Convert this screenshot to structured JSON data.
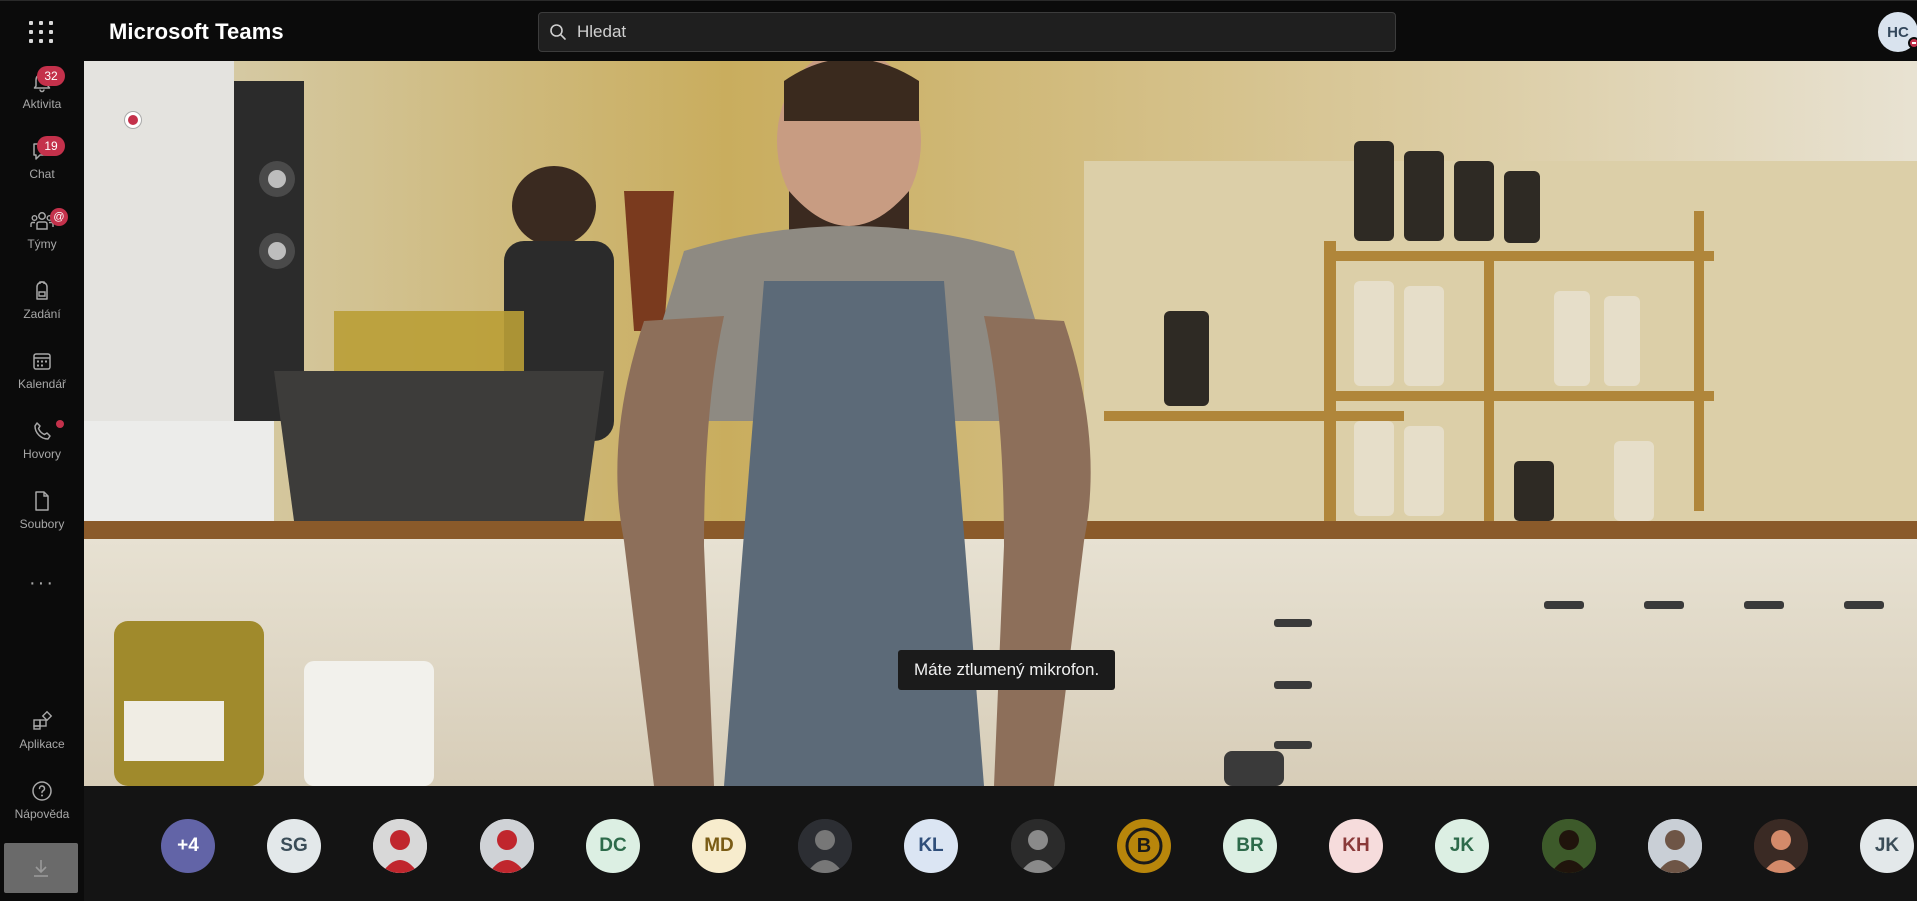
{
  "app": {
    "title": "Microsoft Teams"
  },
  "search": {
    "placeholder": "Hledat"
  },
  "user": {
    "initials": "HC",
    "presence": "busy"
  },
  "rail": {
    "items": [
      {
        "label": "Aktivita",
        "icon": "bell-icon",
        "badge": "32"
      },
      {
        "label": "Chat",
        "icon": "chat-icon",
        "badge": "19"
      },
      {
        "label": "Týmy",
        "icon": "teams-icon",
        "badge": "@"
      },
      {
        "label": "Zadání",
        "icon": "backpack-icon",
        "badge": ""
      },
      {
        "label": "Kalendář",
        "icon": "calendar-icon",
        "badge": ""
      },
      {
        "label": "Hovory",
        "icon": "phone-icon",
        "badge": "dot"
      },
      {
        "label": "Soubory",
        "icon": "file-icon",
        "badge": ""
      }
    ],
    "more": "···",
    "bottom": [
      {
        "label": "Aplikace",
        "icon": "apps-icon"
      },
      {
        "label": "Nápověda",
        "icon": "help-icon"
      }
    ]
  },
  "meeting": {
    "toast": "Máte ztlumený mikrofon.",
    "recording": true
  },
  "participants": [
    {
      "label": "+4",
      "kind": "overflow",
      "bg": "#6264a7",
      "fg": "#ffffff"
    },
    {
      "label": "SG",
      "kind": "initials",
      "bg": "#e3e8ea",
      "fg": "#3b4d58"
    },
    {
      "label": "",
      "kind": "photo",
      "bg": "#d8d8d8",
      "fg": "#c0262d"
    },
    {
      "label": "",
      "kind": "photo",
      "bg": "#cfd2d6",
      "fg": "#c0262d"
    },
    {
      "label": "DC",
      "kind": "initials",
      "bg": "#dcefe3",
      "fg": "#2d6a4a"
    },
    {
      "label": "MD",
      "kind": "initials",
      "bg": "#f7eccd",
      "fg": "#7a5c15"
    },
    {
      "label": "",
      "kind": "photo",
      "bg": "#2c2e33",
      "fg": "#777777"
    },
    {
      "label": "KL",
      "kind": "initials",
      "bg": "#dbe5f3",
      "fg": "#2f4e7a"
    },
    {
      "label": "",
      "kind": "photo",
      "bg": "#2b2b2b",
      "fg": "#8a8a8a"
    },
    {
      "label": "B",
      "kind": "logo",
      "bg": "#b8860b",
      "fg": "#1a1a1a"
    },
    {
      "label": "BR",
      "kind": "initials",
      "bg": "#dcefe3",
      "fg": "#2d6a4a"
    },
    {
      "label": "KH",
      "kind": "initials",
      "bg": "#f6dcdc",
      "fg": "#8a3a3a"
    },
    {
      "label": "JK",
      "kind": "initials",
      "bg": "#dcefe3",
      "fg": "#2d6a4a"
    },
    {
      "label": "",
      "kind": "photo",
      "bg": "#3d5a2a",
      "fg": "#20140c"
    },
    {
      "label": "",
      "kind": "photo",
      "bg": "#c9cfd6",
      "fg": "#6e5546"
    },
    {
      "label": "",
      "kind": "photo",
      "bg": "#3a2a24",
      "fg": "#d48a6a"
    },
    {
      "label": "JK",
      "kind": "initials",
      "bg": "#e3e8ea",
      "fg": "#3b4d58"
    }
  ]
}
